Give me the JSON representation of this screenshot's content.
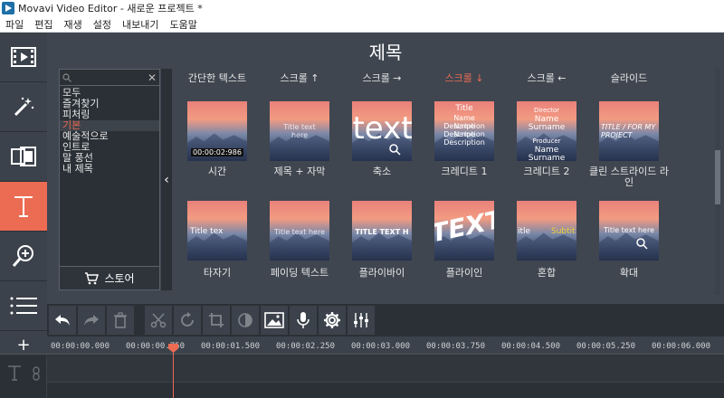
{
  "window": {
    "title": "Movavi Video Editor - 새로운 프로젝트 *"
  },
  "menu": [
    "파일",
    "편집",
    "재생",
    "설정",
    "내보내기",
    "도움말"
  ],
  "panel": {
    "title": "제목"
  },
  "sidebar": {
    "search_placeholder": "",
    "categories": [
      "모두",
      "즐겨찾기",
      "피처링",
      "기본",
      "예술적으로",
      "인트로",
      "말 풍선",
      "내 제목"
    ],
    "selected_index": 3,
    "store_label": "스토어"
  },
  "grid": {
    "headers": [
      "간단한 텍스트",
      "스크롤 ↑",
      "스크롤 →",
      "스크롤 ↓",
      "스크롤 ←",
      "슬라이드"
    ],
    "active_header_index": 3,
    "row1": [
      {
        "label": "시간",
        "thumb": "00:00:02:986"
      },
      {
        "label": "제목 + 자막",
        "thumb": "Title text here"
      },
      {
        "label": "축소",
        "thumb": "text"
      },
      {
        "label": "크레디트 1",
        "thumb_lines": [
          "Title",
          "Name Description",
          "Name Description",
          "Name Description"
        ]
      },
      {
        "label": "크레디트 2",
        "thumb_lines": [
          "Director",
          "Name Surname",
          "Producer",
          "Name Surname"
        ]
      },
      {
        "label": "클린 스트라이드 라인",
        "thumb": "TITLE / FOR MY PROJECT"
      }
    ],
    "row2": [
      {
        "label": "타자기",
        "thumb": "Title tex"
      },
      {
        "label": "페이딩 텍스트",
        "thumb": "Title text here"
      },
      {
        "label": "플라이바이",
        "thumb": "TITLE TEXT H"
      },
      {
        "label": "플라이인",
        "thumb": "TEXT"
      },
      {
        "label": "혼합",
        "thumb": "itle",
        "thumb2": "Subtit"
      },
      {
        "label": "확대",
        "thumb": "Title text here"
      }
    ]
  },
  "timeline": {
    "ticks": [
      "00:00:00.000",
      "00:00:00.750",
      "00:00:01.500",
      "00:00:02.250",
      "00:00:03.000",
      "00:00:03.750",
      "00:00:04.500",
      "00:00:05.250",
      "00:00:06.000"
    ]
  },
  "colors": {
    "accent": "#ec6b53",
    "panel": "#3f4650",
    "dark": "#2b3036"
  }
}
